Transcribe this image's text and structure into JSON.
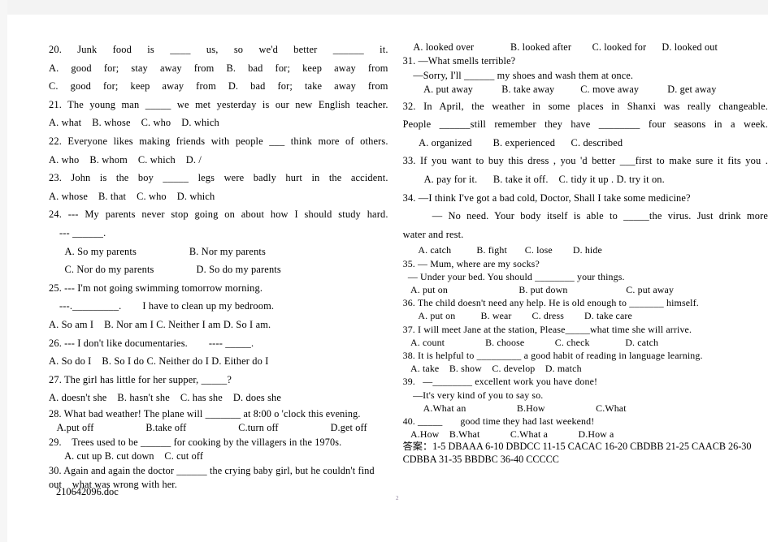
{
  "document": {
    "footer_filename": "210642096.doc",
    "page_number": "2"
  },
  "left_column": {
    "lines": [
      "20. Junk food is ____ us, so we'd better ______ it.",
      "A. good for; stay away from B. bad for; keep away from",
      "C. good for; keep away from D. bad for; take away from",
      "21. The young man _____ we met yesterday is our new English teacher.",
      "A. what    B. whose    C. who    D. which",
      "22. Everyone likes making friends with people ___ think more of others.",
      "A. who    B. whom    C. which    D. /",
      "23. John is the boy _____ legs were badly hurt in the accident.",
      "A. whose    B. that    C. who    D. which",
      "24. --- My parents never stop going on about how I should study hard.",
      "    --- ______.",
      "      A. So my parents                    B. Nor my parents",
      "      C. Nor do my parents                D. So do my parents",
      "25. --- I'm not going swimming tomorrow morning.",
      "    ---._________.        I have to clean up my bedroom.",
      "A. So am I    B. Nor am I C. Neither I am D. So I am.",
      "26. --- I don't like documentaries.        ---- _____.",
      "A. So do I    B. So I do C. Neither do I D. Either do I",
      "27. The girl has little for her supper, _____?",
      "A. doesn't she    B. hasn't she    C. has she    D. does she",
      "28. What bad weather! The plane will _______ at 8:00 o 'clock this evening.",
      "   A.put off                    B.take off                    C.turn off                    D.get off",
      "29.    Trees used to be ______ for cooking by the villagers in the 1970s.",
      "      A. cut up B. cut down    C. cut off",
      "30. Again and again the doctor ______ the crying baby girl, but he couldn't find",
      "out    what was wrong with her."
    ]
  },
  "right_column": {
    "lines": [
      "    A. looked over              B. looked after        C. looked for      D. looked out",
      "31. —What smells terrible?",
      "    —Sorry, I'll ______ my shoes and wash them at once.",
      "        A. put away           B. take away          C. move away           D. get away",
      "32. In April, the weather in some places in Shanxi was really changeable.",
      "People ______still remember they have ________ four seasons in a week.",
      "      A. organized        B. experienced      C. described",
      "33. If you want to buy this dress , you 'd better ___first to make sure it fits you .",
      "        A. pay for it.      B. take it off.    C. tidy it up . D. try it on.",
      "34. —I think I've got a bad cold, Doctor, Shall I take some medicine?",
      "     — No need. Your body itself is able to _____the virus. Just drink more",
      "water and rest.",
      "      A. catch          B. fight       C. lose        D. hide",
      "35. — Mum, where are my socks?",
      "  — Under your bed. You should ________ your things.",
      "   A. put on                            B. put down                       C. put away",
      "36. The child doesn't need any help. He is old enough to _______ himself.",
      "      A. put on          B. wear        C. dress        D. take care",
      "37. I will meet Jane at the station, Please_____what time she will arrive.",
      "   A. count                B. choose            C. check              D. catch",
      "38. It is helpful to _________ a good habit of reading in language learning.",
      "   A. take    B. show    C. develop    D. match",
      "39.   —________ excellent work you have done!",
      "    —It's very kind of you to say so.",
      "        A.What an                    B.How                    C.What",
      "40. _____       good time they had last weekend!",
      "   A.How    B.What            C.What a            D.How a"
    ],
    "answer_key": "答案：1-5 DBAAA 6-10 DBDCC 11-15 CACAC 16-20 CBDBB 21-25 CAACB 26-30 CDBBA 31-35 BBDBC 36-40 CCCCC"
  }
}
